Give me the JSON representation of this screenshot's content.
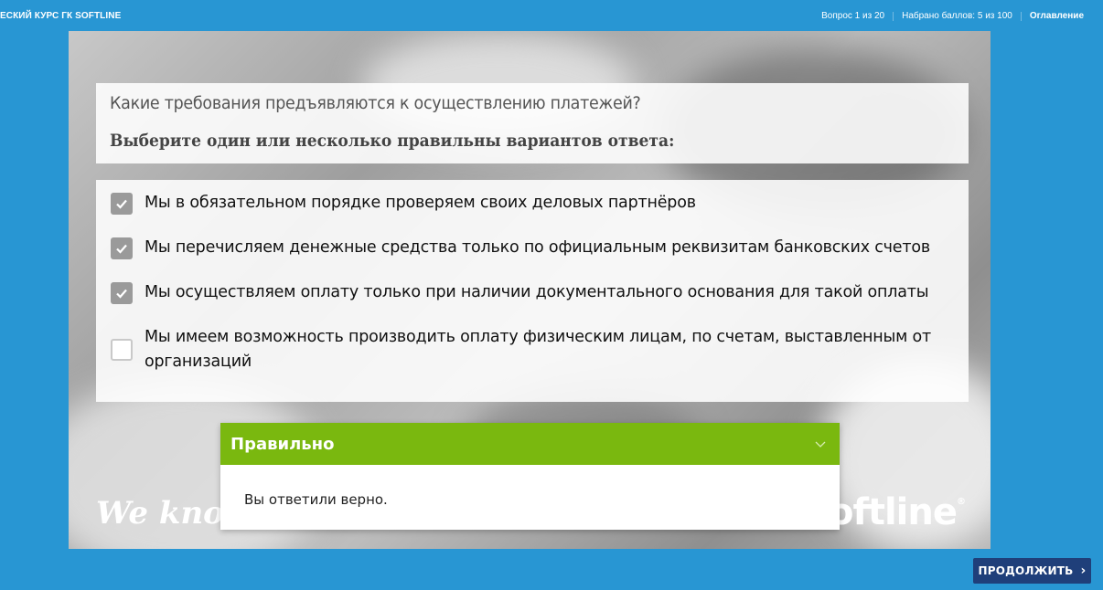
{
  "header": {
    "course_title": "ЕСКИЙ КУРС ГК SOFTLINE",
    "question_counter": "Вопрос 1 из 20",
    "score": "Набрано баллов: 5 из 100",
    "toc_label": "Оглавление"
  },
  "question": {
    "text": "Какие требования предъявляются к осуществлению платежей?",
    "instruction": "Выберите один или несколько правильны вариантов ответа:"
  },
  "answers": [
    {
      "label": "Мы в обязательном порядке проверяем своих деловых партнёров",
      "checked": true
    },
    {
      "label": "Мы перечисляем денежные средства только по официальным реквизитам банковских счетов",
      "checked": true
    },
    {
      "label": "Мы осуществляем оплату только при наличии документального основания для такой оплаты",
      "checked": true
    },
    {
      "label": "Мы имеем возможность производить оплату физическим лицам, по счетам, выставленным от организаций",
      "checked": false
    }
  ],
  "feedback": {
    "title": "Правильно",
    "message": "Вы ответили верно."
  },
  "watermark": {
    "left": "We know what",
    "right": "softline"
  },
  "continue_button": {
    "label": "ПРОДОЛЖИТЬ"
  },
  "colors": {
    "background": "#2896d3",
    "feedback_header": "#7ab80f",
    "continue_button": "#1f3f7a",
    "checkbox_checked": "#9a9a9a"
  }
}
